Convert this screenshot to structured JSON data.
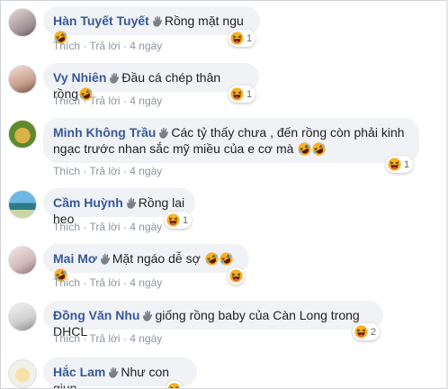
{
  "actions": {
    "like": "Thích",
    "reply": "Trả lời",
    "sep": "·"
  },
  "comments": [
    {
      "author": "Hàn Tuyết Tuyết",
      "text": "Rồng mặt ngu",
      "text2": "",
      "emojis": 1,
      "time": "4 ngày",
      "reactions": "1"
    },
    {
      "author": "Vy Nhiên",
      "text": "Đầu cá chép thân rồng",
      "text2": "",
      "emojis": 1,
      "time": "4 ngày",
      "reactions": "1"
    },
    {
      "author": "Minh Không Trầu",
      "text": "Các tỷ thấy chưa , đến rồng còn phải kinh",
      "text2": "ngạc trước nhan sắc mỹ miều của e cơ mà",
      "emojis": 2,
      "time": "4 ngày",
      "reactions": "1"
    },
    {
      "author": "Cầm Huỳnh",
      "text": "Rồng lai heo",
      "text2": "",
      "emojis": 0,
      "time": "4 ngày",
      "reactions": "1"
    },
    {
      "author": "Mai Mơ",
      "text": "Mặt ngáo dễ sợ",
      "text2": "",
      "emojis": 3,
      "time": "4 ngày",
      "reactions": ""
    },
    {
      "author": "Đồng Văn Nhu",
      "text": "giống rồng baby của Càn Long trong DHCL",
      "text2": "",
      "emojis": 0,
      "time": "4 ngày",
      "reactions": "2"
    },
    {
      "author": "Hắc Lam",
      "text": "Như con giun",
      "text2": "",
      "emojis": 0,
      "time": "",
      "reactions": ""
    }
  ],
  "colors": {
    "author": "#385898",
    "bubble": "#f0f2f5",
    "meta": "#8d949e",
    "emoji": "#f7b125"
  },
  "icons": {
    "wave": "waving-hand-icon",
    "emoji": "laughing-emoji-icon"
  }
}
